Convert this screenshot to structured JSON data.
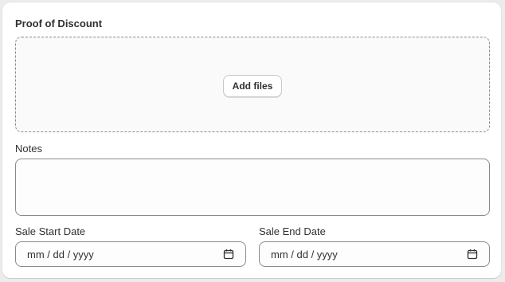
{
  "form": {
    "proof_title": "Proof of Discount",
    "add_files_label": "Add files",
    "notes_label": "Notes",
    "notes_value": "",
    "start_label": "Sale Start Date",
    "start_placeholder": "mm / dd / yyyy",
    "end_label": "Sale End Date",
    "end_placeholder": "mm / dd / yyyy"
  },
  "icons": {
    "date_picker": "calendar-icon"
  },
  "colors": {
    "card_bg": "#ffffff",
    "page_bg": "#ececec",
    "text": "#303030",
    "border": "#8a8a8a"
  }
}
